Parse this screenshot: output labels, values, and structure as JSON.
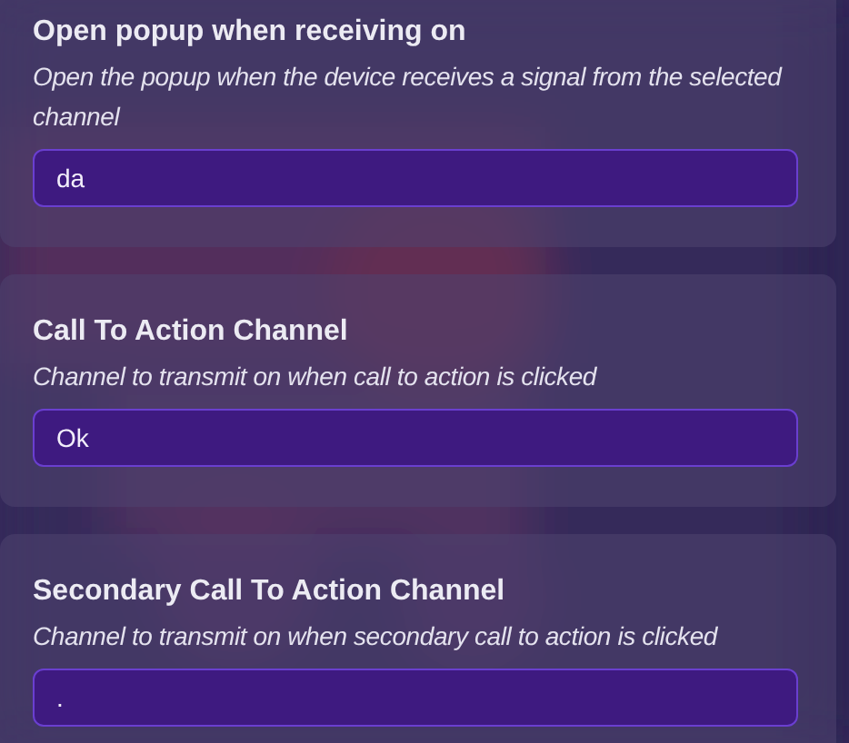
{
  "settings": [
    {
      "title": "Open popup when receiving on",
      "description": "Open the popup when the device receives a signal from the selected channel",
      "value": "da"
    },
    {
      "title": "Call To Action Channel",
      "description": "Channel to transmit on when call to action is clicked",
      "value": "Ok"
    },
    {
      "title": "Secondary Call To Action Channel",
      "description": "Channel to transmit on when secondary call to action is clicked",
      "value": "."
    }
  ]
}
